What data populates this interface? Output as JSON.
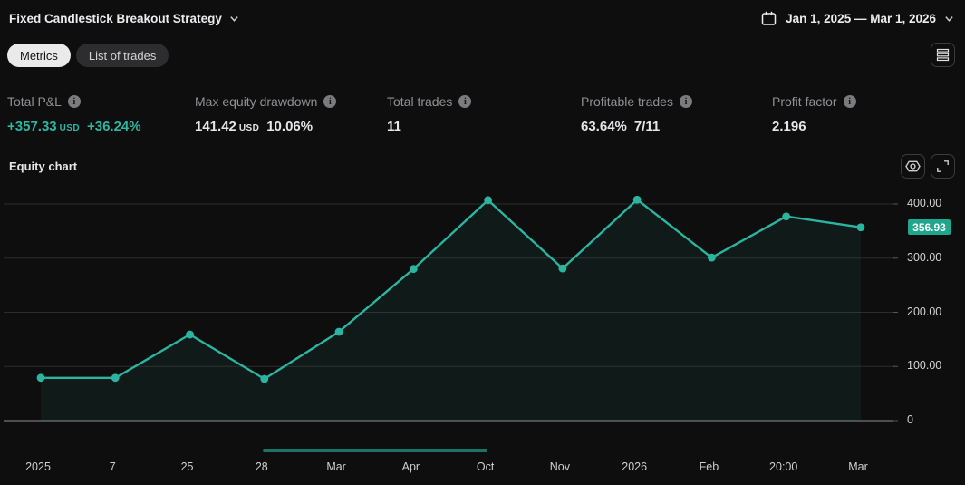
{
  "header": {
    "title": "Fixed Candlestick Breakout Strategy",
    "date_range": "Jan 1, 2025 — Mar 1, 2026"
  },
  "tabs": [
    {
      "label": "Metrics",
      "active": true
    },
    {
      "label": "List of trades",
      "active": false
    }
  ],
  "metrics": [
    {
      "label": "Total P&L",
      "value": "+357.33",
      "currency": "USD",
      "extra": "+36.24%"
    },
    {
      "label": "Max equity drawdown",
      "value": "141.42",
      "currency": "USD",
      "extra": "10.06%"
    },
    {
      "label": "Total trades",
      "value": "11"
    },
    {
      "label": "Profitable trades",
      "value": "63.64%",
      "extra": "7/11"
    },
    {
      "label": "Profit factor",
      "value": "2.196"
    }
  ],
  "section": {
    "title": "Equity chart"
  },
  "chart_data": {
    "type": "line",
    "title": "Equity chart",
    "x_labels": [
      "2025",
      "7",
      "25",
      "28",
      "Mar",
      "Apr",
      "Oct",
      "Nov",
      "2026",
      "Feb",
      "20:00",
      "Mar"
    ],
    "values": [
      79,
      79,
      159,
      77,
      164,
      280,
      407,
      281,
      408,
      301,
      377,
      356.93
    ],
    "y_ticks": [
      {
        "value": 0,
        "label": "0"
      },
      {
        "value": 100,
        "label": "100.00"
      },
      {
        "value": 200,
        "label": "200.00"
      },
      {
        "value": 300,
        "label": "300.00"
      },
      {
        "value": 400,
        "label": "400.00"
      }
    ],
    "ylim": [
      0,
      433
    ],
    "grid": true,
    "legend": "none",
    "current_value": 356.93,
    "current_value_label": "356.93"
  },
  "colors": {
    "line": "#2bb5a0",
    "area_fill": "rgba(43,181,160,0.07)",
    "badge_bg": "#1ea78c",
    "positive_text": "#2fb5a1",
    "gridline": "#2c2c2e",
    "baseline": "#8e8e90",
    "scrollbar": "#1c7466",
    "background": "#0e0e0f"
  }
}
